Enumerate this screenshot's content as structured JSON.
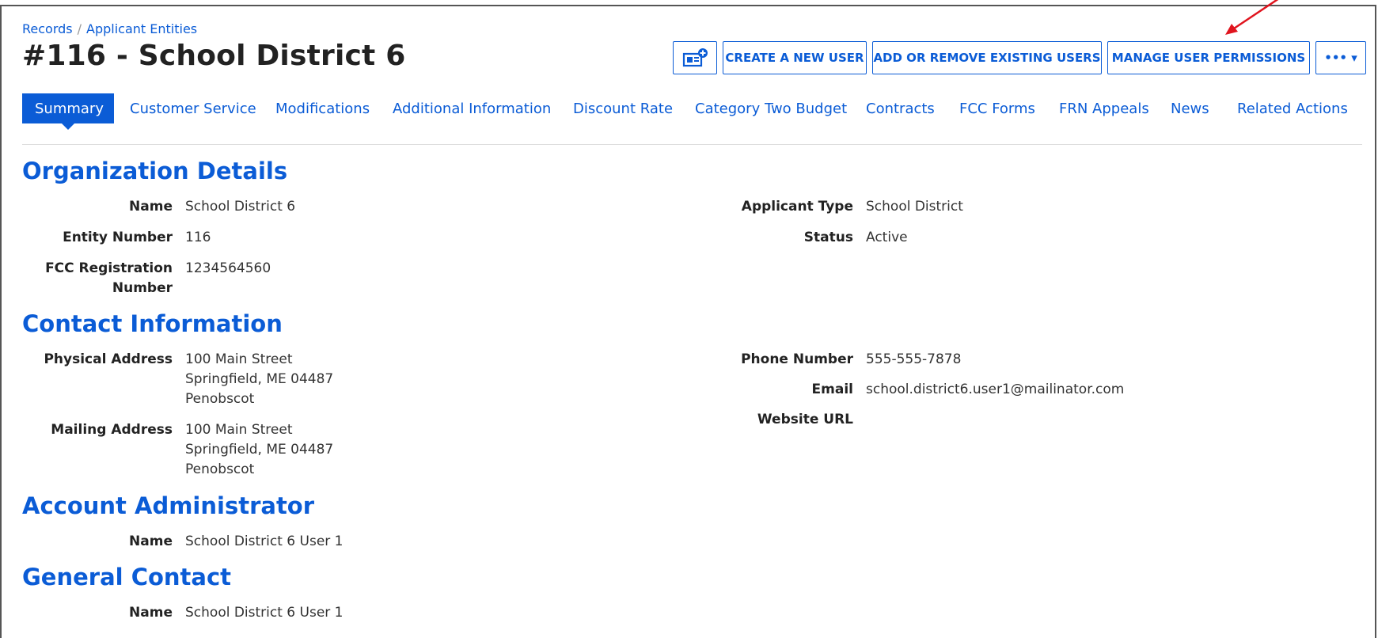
{
  "breadcrumb": {
    "root": "Records",
    "separator": "/",
    "current": "Applicant Entities"
  },
  "page_title": "#116 - School District 6",
  "toolbar": {
    "icon_button": "news-plus-icon",
    "create_user": "CREATE A NEW USER",
    "add_remove_users": "ADD OR REMOVE EXISTING USERS",
    "manage_permissions": "MANAGE USER PERMISSIONS",
    "more_label": "••• ▾"
  },
  "tabs": [
    {
      "label": "Summary",
      "active": true
    },
    {
      "label": "Customer Service"
    },
    {
      "label": "Modifications"
    },
    {
      "label": "Additional Information"
    },
    {
      "label": "Discount Rate"
    },
    {
      "label": "Category Two Budget"
    },
    {
      "label": "Contracts"
    },
    {
      "label": "FCC Forms"
    },
    {
      "label": "FRN Appeals"
    },
    {
      "label": "News"
    },
    {
      "label": "Related Actions"
    }
  ],
  "organization": {
    "title": "Organization Details",
    "name_label": "Name",
    "name": "School District 6",
    "entity_number_label": "Entity Number",
    "entity_number": "116",
    "fcc_reg_label_1": "FCC Registration",
    "fcc_reg_label_2": "Number",
    "fcc_reg": "1234564560",
    "applicant_type_label": "Applicant Type",
    "applicant_type": "School District",
    "status_label": "Status",
    "status": "Active"
  },
  "contact": {
    "title": "Contact Information",
    "physical_label": "Physical Address",
    "physical": [
      "100 Main Street",
      "Springfield, ME 04487",
      "Penobscot"
    ],
    "mailing_label": "Mailing Address",
    "mailing": [
      "100 Main Street",
      "Springfield, ME 04487",
      "Penobscot"
    ],
    "phone_label": "Phone Number",
    "phone": "555-555-7878",
    "email_label": "Email",
    "email": "school.district6.user1@mailinator.com",
    "website_label": "Website URL",
    "website": ""
  },
  "account_admin": {
    "title": "Account Administrator",
    "name_label": "Name",
    "name": "School District 6 User 1"
  },
  "general_contact": {
    "title": "General Contact",
    "name_label": "Name",
    "name": "School District 6 User 1"
  },
  "colors": {
    "accent": "#0b5cd6",
    "annotation_arrow": "#e0141e"
  }
}
